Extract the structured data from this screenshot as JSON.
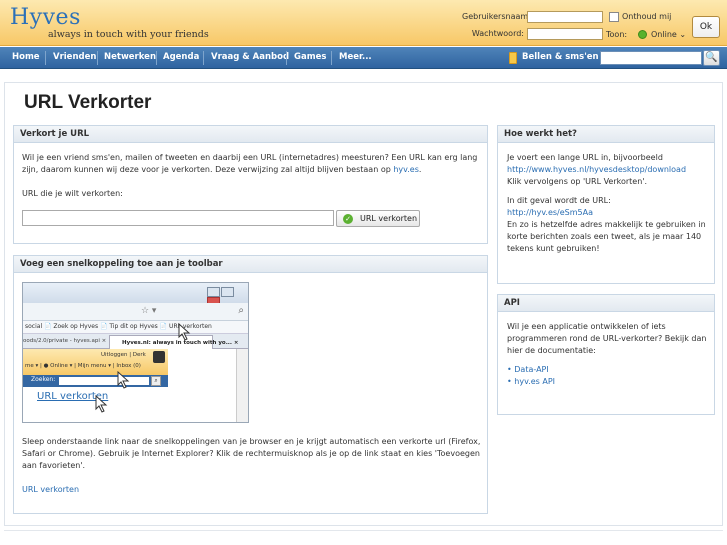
{
  "header": {
    "logo_text": "Hyves",
    "tagline": "always in touch with your friends",
    "username_label": "Gebruikersnaam:",
    "password_label": "Wachtwoord:",
    "remember_label": "Onthoud mij",
    "status_label": "Toon:",
    "status_value": "Online ⌄",
    "ok_label": "Ok"
  },
  "nav": {
    "items": [
      "Home",
      "Vrienden",
      "Netwerken",
      "Agenda",
      "Vraag & Aanbod",
      "Games",
      "Meer..."
    ],
    "sms_label": "Bellen & sms'en",
    "search_button": "🔍"
  },
  "page": {
    "title": "URL Verkorter"
  },
  "shorten": {
    "heading": "Verkort je URL",
    "intro_1": "Wil je een vriend sms'en, mailen of tweeten en daarbij een URL (internetadres) meesturen? Een URL kan erg lang",
    "intro_2": "zijn, daarom kunnen wij deze voor je verkorten. Deze verwijzing zal altijd blijven bestaan op",
    "intro_link": "hyv.es",
    "intro_end": ".",
    "field_label": "URL die je wilt verkorten:",
    "input_value": "",
    "button_label": "URL verkorten"
  },
  "toolbar": {
    "heading": "Voeg een snelkoppeling toe aan je toolbar",
    "desc_1": "Sleep onderstaande link naar de snelkoppelingen van je browser en je krijgt automatisch een verkorte url (Firefox,",
    "desc_2": "Safari or Chrome). Gebruik je Internet Explorer? Klik de rechtermuisknop als je op de link staat en kies 'Toevoegen",
    "desc_3": "aan favorieten'.",
    "link_label": "URL verkorten",
    "illustration": {
      "bookmarks": "social  📄 Zoek op Hyves  📄 Tip dit op Hyves  📄 URL verkorten",
      "tab_left": "oods/2.0/private - hyves.api   ×",
      "tab_active": "Hyves.nl: always in touch with yo...  ×",
      "strip_line_1": "Uitloggen  |  Derk",
      "strip_line_2": "me ▾  |  ● Online ▾  |  Mijn menu ▾  |  Inbox (0)",
      "search_label": "Zoeken:",
      "link_text": "URL verkorten"
    }
  },
  "how": {
    "heading": "Hoe werkt het?",
    "line_1": "Je voert een lange URL in, bijvoorbeeld",
    "example_long": "http://www.hyves.nl/hyvesdesktop/download",
    "line_2": "Klik vervolgens op 'URL Verkorten'.",
    "line_3": "In dit geval wordt de URL:",
    "example_short": "http://hyv.es/eSm5Aa",
    "line_4": "En zo is hetzelfde adres makkelijk te gebruiken in",
    "line_5": "korte berichten zoals een tweet, als je maar 140",
    "line_6": "tekens kunt gebruiken!"
  },
  "api": {
    "heading": "API",
    "line_1": "Wil je een applicatie ontwikkelen of iets",
    "line_2": "programmeren rond de URL-verkorter? Bekijk dan",
    "line_3": "hier de documentatie:",
    "links": [
      "• Data-API",
      "• hyv.es API"
    ]
  },
  "colors": {
    "header_bg": "#f7c867",
    "nav_bg": "#3467a3",
    "link": "#2a6db2"
  }
}
